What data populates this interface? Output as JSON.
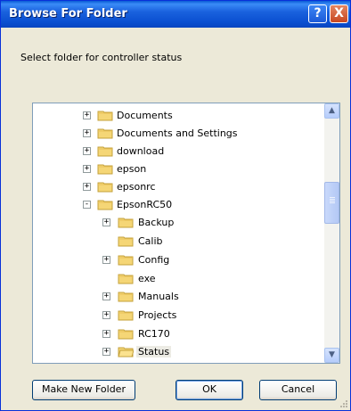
{
  "window": {
    "title": "Browse For Folder",
    "help_label": "?",
    "close_label": "X"
  },
  "instruction": "Select folder for controller status",
  "tree": {
    "items": [
      {
        "label": "Documents",
        "expander": "+",
        "level": 0
      },
      {
        "label": "Documents and Settings",
        "expander": "+",
        "level": 0
      },
      {
        "label": "download",
        "expander": "+",
        "level": 0
      },
      {
        "label": "epson",
        "expander": "+",
        "level": 0
      },
      {
        "label": "epsonrc",
        "expander": "+",
        "level": 0
      },
      {
        "label": "EpsonRC50",
        "expander": "-",
        "level": 0
      },
      {
        "label": "Backup",
        "expander": "+",
        "level": 1
      },
      {
        "label": "Calib",
        "expander": "",
        "level": 1
      },
      {
        "label": "Config",
        "expander": "+",
        "level": 1
      },
      {
        "label": "exe",
        "expander": "",
        "level": 1
      },
      {
        "label": "Manuals",
        "expander": "+",
        "level": 1
      },
      {
        "label": "Projects",
        "expander": "+",
        "level": 1
      },
      {
        "label": "RC170",
        "expander": "+",
        "level": 1
      },
      {
        "label": "Status",
        "expander": "+",
        "level": 1,
        "selected": true
      }
    ]
  },
  "buttons": {
    "new_folder": "Make New Folder",
    "ok": "OK",
    "cancel": "Cancel"
  },
  "colors": {
    "titlebar": "#0a4fd0",
    "dialog_bg": "#ece9d8",
    "folder": "#f5d676",
    "selection": "#ecebe4"
  }
}
